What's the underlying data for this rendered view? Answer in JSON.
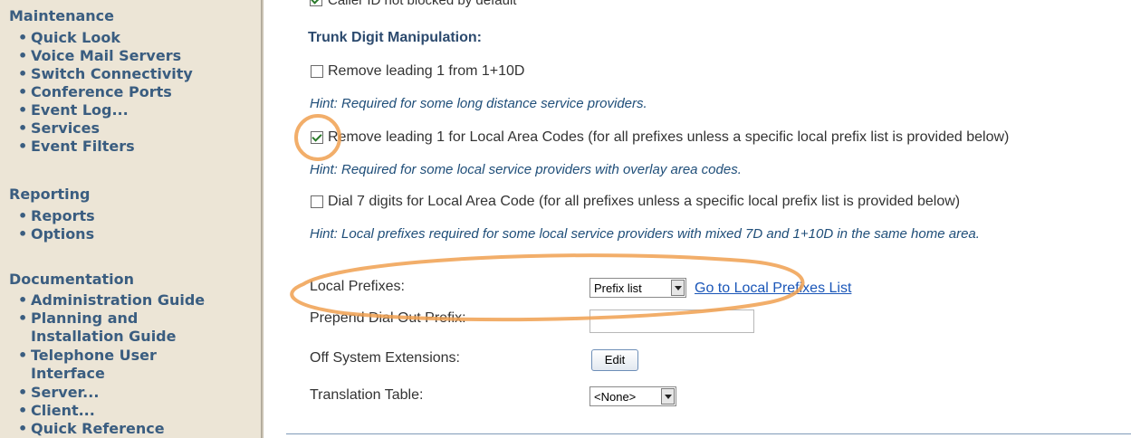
{
  "sidebar": {
    "maintenance": {
      "heading": "Maintenance",
      "items": [
        "Quick Look",
        "Voice Mail Servers",
        "Switch Connectivity",
        "Conference Ports",
        "Event Log...",
        "Services",
        "Event Filters"
      ]
    },
    "reporting": {
      "heading": "Reporting",
      "items": [
        "Reports",
        "Options"
      ]
    },
    "documentation": {
      "heading": "Documentation",
      "items": [
        {
          "line1": "Administration Guide"
        },
        {
          "line1": "Planning and",
          "line2": "Installation Guide"
        },
        {
          "line1": "Telephone User",
          "line2": "Interface"
        },
        {
          "line1": "Server..."
        },
        {
          "line1": "Client..."
        },
        {
          "line1": "Quick Reference"
        }
      ]
    }
  },
  "main": {
    "caller_id_option": {
      "label": "Caller ID not blocked by default",
      "checked": true
    },
    "section_title": "Trunk Digit Manipulation:",
    "options": [
      {
        "label": "Remove leading 1 from 1+10D",
        "checked": false,
        "hint": "Hint: Required for some long distance service providers."
      },
      {
        "label": "Remove leading 1 for Local Area Codes (for all prefixes unless a specific local prefix list is provided below)",
        "checked": true,
        "hint": "Hint: Required for some local service providers with overlay area codes."
      },
      {
        "label": "Dial 7 digits for Local Area Code (for all prefixes unless a specific local prefix list is provided below)",
        "checked": false,
        "hint": "Hint: Local prefixes required for some local service providers with mixed 7D and 1+10D in the same home area."
      }
    ],
    "local_prefixes": {
      "label": "Local Prefixes:",
      "select_value": "Prefix list",
      "link_text": "Go to Local Prefixes List"
    },
    "prepend": {
      "label": "Prepend Dial Out Prefix:",
      "value": ""
    },
    "off_system": {
      "label": "Off System Extensions:",
      "button_label": "Edit"
    },
    "translation": {
      "label": "Translation Table:",
      "select_value": "<None>"
    }
  },
  "colors": {
    "sidebar_bg": "#ece5d6",
    "sidebar_text": "#3a5d80",
    "hint_text": "#1f4e79",
    "link": "#1a56b8",
    "annotation": "#f0a050"
  }
}
